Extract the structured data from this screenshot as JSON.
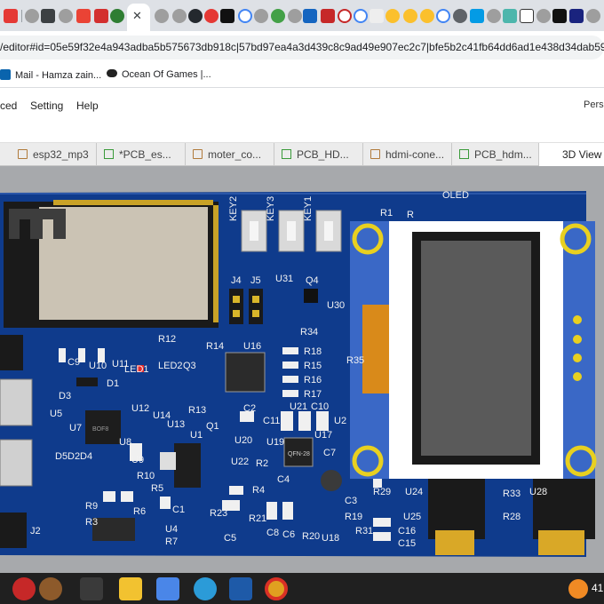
{
  "browser": {
    "active_tab_close": "✕",
    "url": "/editor#id=05e59f32e4a943adba5b575673db918c|57bd97ea4a3d439c8c9ad49e907ec2c7|bfe5b2c41fb64dd6ad1e438d34dab59c|6",
    "bookmarks": [
      {
        "label": "Mail - Hamza zain...",
        "icon": "outlook-icon",
        "color": "#0a64ad"
      },
      {
        "label": "Ocean Of Games |...",
        "icon": "gamepad-icon",
        "color": "#222222"
      }
    ]
  },
  "app": {
    "menu": [
      "ced",
      "Setting",
      "Help"
    ],
    "user": "Pers",
    "tabs": [
      {
        "label": "esp32_mp3",
        "icon": "folder-icon"
      },
      {
        "label": "*PCB_es...",
        "icon": "pcb-icon"
      },
      {
        "label": "moter_co...",
        "icon": "folder-icon"
      },
      {
        "label": "PCB_HD...",
        "icon": "pcb-icon"
      },
      {
        "label": "hdmi-cone...",
        "icon": "folder-icon"
      },
      {
        "label": "PCB_hdm...",
        "icon": "pcb-icon"
      },
      {
        "label": "3D View",
        "icon": ""
      }
    ]
  },
  "pcb": {
    "board_color": "#0f3b8c",
    "silk_labels": {
      "oled": "OLED",
      "key2": "KEY2",
      "key3": "KEY3",
      "key1": "KEY1",
      "j4": "J4",
      "j5": "J5",
      "u31": "U31",
      "q4": "Q4",
      "u30": "U30",
      "r34": "R34",
      "r35": "R35",
      "r12": "R12",
      "r14": "R14",
      "u16": "U16",
      "led1": "LED1",
      "led2": "LED2",
      "q3": "Q3",
      "c9": "C9",
      "u10": "U10",
      "u11": "U11",
      "d1": "D1",
      "d3": "D3",
      "u5": "U5",
      "r18": "R18",
      "r15": "R15",
      "r16": "R16",
      "r17": "R17",
      "u12": "U12",
      "u14": "U14",
      "u13": "U13",
      "r13": "R13",
      "q1": "Q1",
      "u7": "U7",
      "c2": "C2",
      "c11": "C11",
      "u21": "U21",
      "c10": "C10",
      "u2": "U2",
      "u17": "U17",
      "u20": "U20",
      "u19": "U19",
      "u22": "U22",
      "c7": "C7",
      "r2": "R2",
      "r4": "R4",
      "c4": "C4",
      "u8": "U8",
      "u9": "U9",
      "u1": "U1",
      "d5": "D5",
      "d2": "D2",
      "d4": "D4",
      "r10": "R10",
      "r5": "R5",
      "r9": "R9",
      "r3": "R3",
      "r6": "R6",
      "c1": "C1",
      "u4": "U4",
      "r7": "R7",
      "j2": "J2",
      "r23": "R23",
      "r21": "R21",
      "c5": "C5",
      "c8": "C8",
      "c6": "C6",
      "r20": "R20",
      "u18": "U18",
      "r19": "R19",
      "r31": "R31",
      "c3": "C3",
      "r29": "R29",
      "u24": "U24",
      "u25": "U25",
      "c16": "C16",
      "c15": "C15",
      "r33": "R33",
      "r28": "R28",
      "u28": "U28",
      "r1": "R1",
      "r_top": "R",
      "qfn": "QFN-28",
      "chip": "BOF8"
    }
  },
  "taskbar": {
    "clock": "41"
  },
  "colors": {
    "chrome_bg": "#dee1e6",
    "board": "#0f3b8c",
    "oled_pcb": "#3a68c6",
    "gold": "#d9b62a",
    "taskbar": "#202020"
  }
}
